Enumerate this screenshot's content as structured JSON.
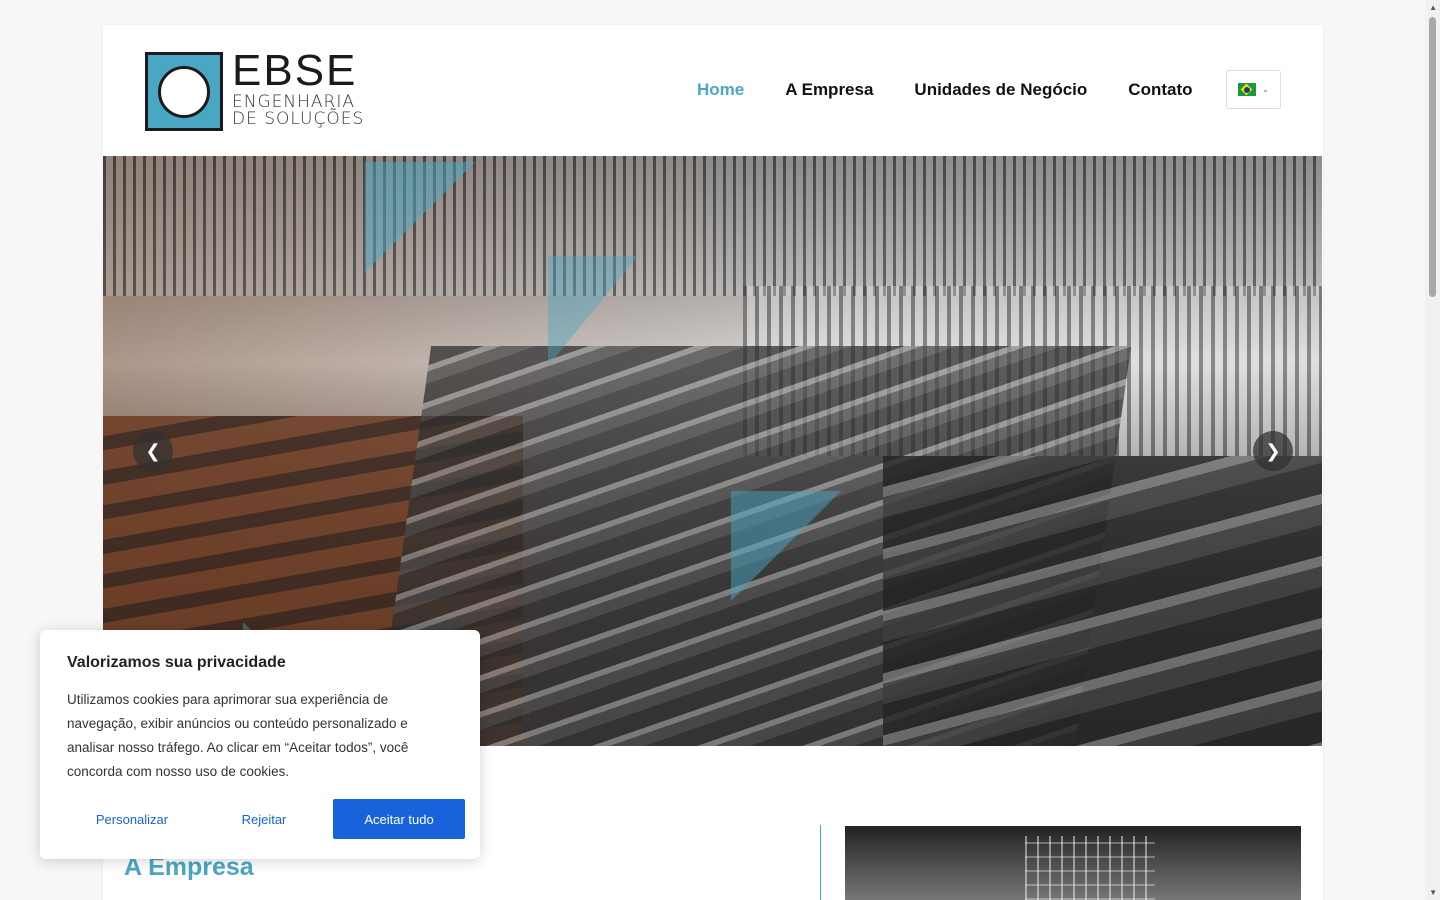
{
  "brand": {
    "name": "EBSE",
    "line1": "ENGENHARIA",
    "line2": "DE SOLUÇÕES"
  },
  "nav": {
    "items": [
      {
        "label": "Home",
        "active": true
      },
      {
        "label": "A Empresa",
        "active": false
      },
      {
        "label": "Unidades de Negócio",
        "active": false
      },
      {
        "label": "Contato",
        "active": false
      }
    ],
    "language": "pt-BR"
  },
  "hero": {
    "prev_icon": "chevron-left-icon",
    "next_icon": "chevron-right-icon"
  },
  "section": {
    "title": "A Empresa"
  },
  "cookie": {
    "title": "Valorizamos sua privacidade",
    "text": "Utilizamos cookies para aprimorar sua experiência de navegação, exibir anúncios ou conteúdo personalizado e analisar nosso tráfego. Ao clicar em “Aceitar todos”, você concorda com nosso uso de cookies.",
    "customize_label": "Personalizar",
    "reject_label": "Rejeitar",
    "accept_label": "Aceitar tudo"
  },
  "colors": {
    "accent": "#4aa7c4",
    "button": "#1863dc"
  }
}
